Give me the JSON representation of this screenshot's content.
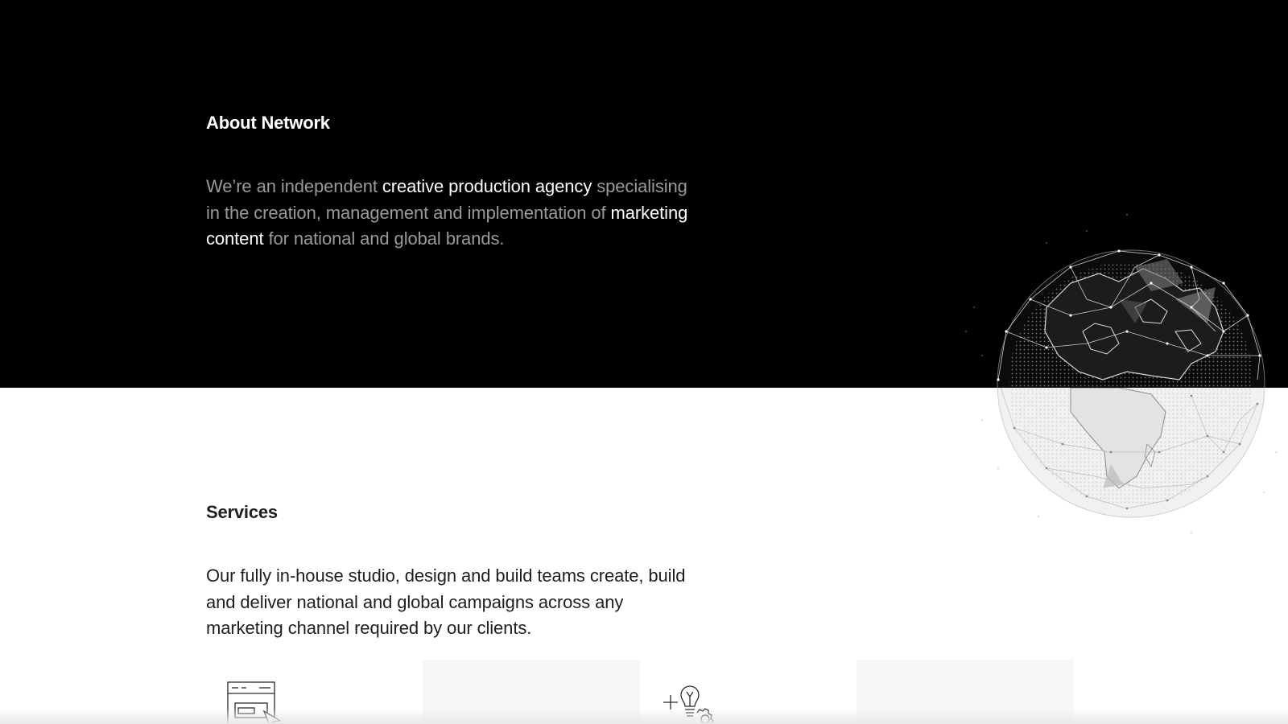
{
  "about": {
    "heading": "About Network",
    "body": [
      {
        "text": "We’re an independent ",
        "highlight": false
      },
      {
        "text": "creative production agency",
        "highlight": true
      },
      {
        "text": " specialising in the creation, management and implementation of ",
        "highlight": false
      },
      {
        "text": "marketing content",
        "highlight": true
      },
      {
        "text": " for national and global brands.",
        "highlight": false
      }
    ]
  },
  "globe": {
    "icon": "globe-network-illustration"
  },
  "services": {
    "heading": "Services",
    "body": "Our fully in-house studio, design and build teams create, build and deliver national and global campaigns across any marketing channel required by our clients.",
    "cards": [
      {
        "icon": "browser-window-cursor-icon"
      },
      {
        "icon": ""
      },
      {
        "icon": "lightbulb-gear-icon"
      },
      {
        "icon": ""
      }
    ]
  },
  "colors": {
    "about_background": "#000000",
    "about_text_muted": "#9a9a9a",
    "about_text_highlight": "#ffffff",
    "services_text": "#1e1e1e",
    "card_background": "#f7f7f7"
  }
}
